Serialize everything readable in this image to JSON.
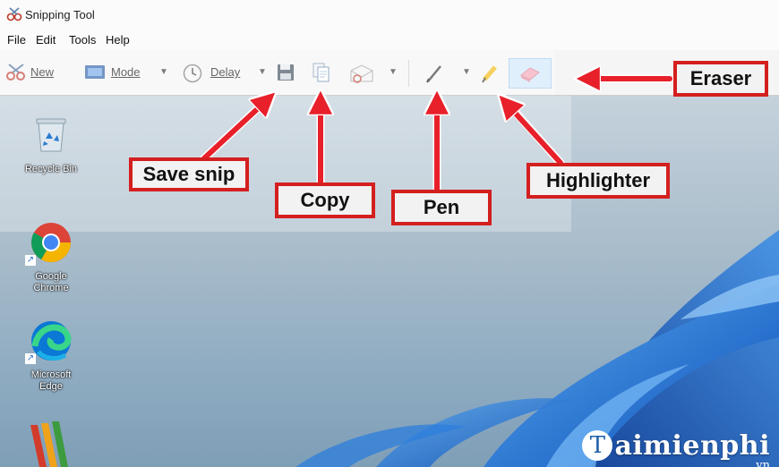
{
  "window": {
    "title": "Snipping Tool"
  },
  "menu": {
    "items": [
      "File",
      "Edit",
      "Tools",
      "Help"
    ]
  },
  "toolbar": {
    "new_label": "New",
    "mode_label": "Mode",
    "delay_label": "Delay"
  },
  "callouts": {
    "save": "Save snip",
    "copy": "Copy",
    "pen": "Pen",
    "highlighter": "Highlighter",
    "eraser": "Eraser"
  },
  "desktop": {
    "icons": [
      {
        "label": "Recycle Bin"
      },
      {
        "label": "Google Chrome"
      },
      {
        "label": "Microsoft Edge"
      }
    ]
  },
  "watermark": {
    "main": "aimienphi",
    "sub": ".vn"
  },
  "colors": {
    "callout_border": "#d41f1f",
    "arrow": "#e8202a",
    "wallpaper_blue": "#1f6fd6"
  }
}
